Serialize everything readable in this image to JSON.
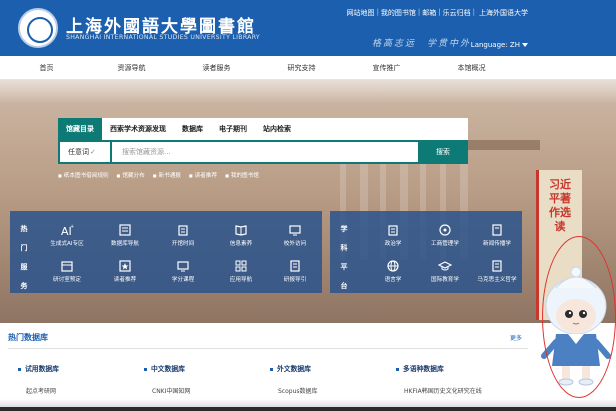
{
  "header": {
    "logo_cn": "上海外國語大學圖書館",
    "logo_en": "SHANGHAI INTERNATIONAL STUDIES UNIVERSITY LIBRARY",
    "top_links": [
      "网站地图",
      "我的图书馆",
      "邮箱",
      "乐云归档"
    ],
    "top_links_tail": "上海外国语大学",
    "motto": "格高志远　学贯中外",
    "language_label": "Language: ZH"
  },
  "nav": {
    "items": [
      "首页",
      "资源导航",
      "读者服务",
      "研究支持",
      "宣传推广",
      "本馆概况"
    ]
  },
  "search": {
    "tabs": [
      "馆藏目录",
      "西索学术资源发现",
      "数据库",
      "电子期刊",
      "站内检索"
    ],
    "active_tab": 0,
    "scope_label": "任意词",
    "placeholder": "搜索馆藏资源...",
    "button_label": "搜索",
    "quick_links": [
      "纸本图书借阅规则",
      "馆藏分布",
      "新书通报",
      "读者推荐",
      "我的图书馆"
    ]
  },
  "services": {
    "left_label": [
      "热",
      "门",
      "服",
      "务"
    ],
    "left_items": [
      {
        "label": "生成式AI专区",
        "icon": "ai-icon"
      },
      {
        "label": "数据库导航",
        "icon": "database-icon"
      },
      {
        "label": "开馆时间",
        "icon": "building-icon"
      },
      {
        "label": "信息素养",
        "icon": "book-icon"
      },
      {
        "label": "校外访问",
        "icon": "monitor-icon"
      },
      {
        "label": "研讨室预定",
        "icon": "calendar-icon"
      },
      {
        "label": "读者推荐",
        "icon": "star-icon"
      },
      {
        "label": "学分课程",
        "icon": "monitor-icon"
      },
      {
        "label": "应用导航",
        "icon": "grid-icon"
      },
      {
        "label": "研报导引",
        "icon": "report-icon"
      }
    ],
    "right_label": [
      "学",
      "科",
      "平",
      "台"
    ],
    "right_items": [
      {
        "label": "政治学",
        "icon": "building-icon"
      },
      {
        "label": "工商管理学",
        "icon": "compass-icon"
      },
      {
        "label": "新闻传播学",
        "icon": "book-icon"
      },
      {
        "label": "语言学",
        "icon": "globe-icon"
      },
      {
        "label": "国际教育学",
        "icon": "cap-icon"
      },
      {
        "label": "马克思主义哲学",
        "icon": "book-icon"
      }
    ]
  },
  "hero": {
    "book_title": "习近平著作选读"
  },
  "hot_db": {
    "title": "热门数据库",
    "more_label": "更多",
    "columns": [
      {
        "heading": "试用数据库",
        "item": "起点考研网"
      },
      {
        "heading": "中文数据库",
        "item": "CNKI中国知网"
      },
      {
        "heading": "外文数据库",
        "item": "Scopus数据库"
      },
      {
        "heading": "多语种数据库",
        "item": "HKFIA韩国历史文化研究在线"
      }
    ]
  },
  "colors": {
    "header_blue": "#1c5fae",
    "search_teal": "#0e7a76",
    "service_blue": "#2a548c",
    "accent_red": "#c8372d"
  }
}
